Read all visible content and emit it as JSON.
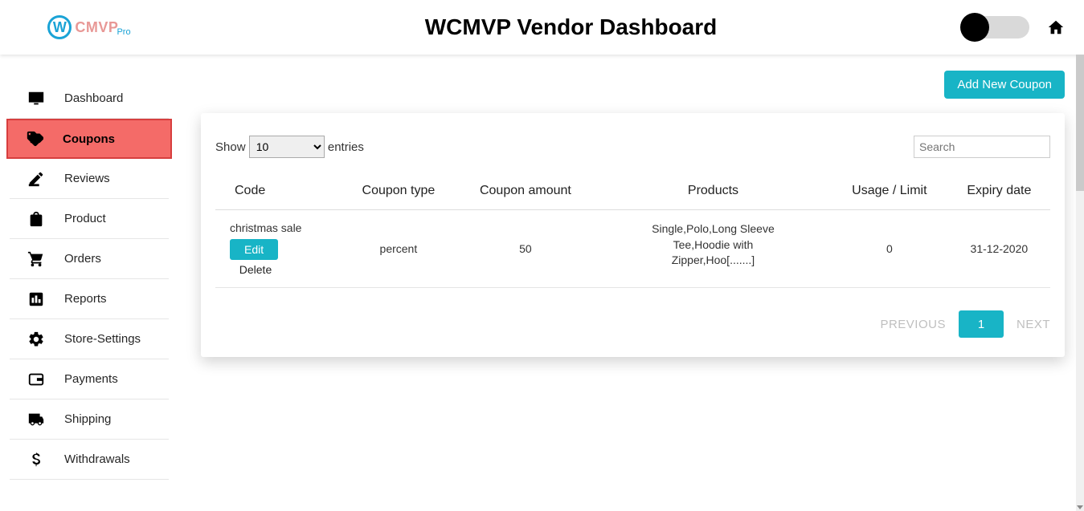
{
  "header": {
    "title": "WCMVP Vendor Dashboard",
    "logo_letter": "W",
    "logo_text": "CMVP",
    "logo_sub": "Pro"
  },
  "sidebar": {
    "items": [
      {
        "label": "Dashboard",
        "icon": "monitor-icon"
      },
      {
        "label": "Coupons",
        "icon": "tag-icon",
        "active": true
      },
      {
        "label": "Reviews",
        "icon": "edit-icon"
      },
      {
        "label": "Product",
        "icon": "bag-icon"
      },
      {
        "label": "Orders",
        "icon": "cart-icon"
      },
      {
        "label": "Reports",
        "icon": "chart-icon"
      },
      {
        "label": "Store-Settings",
        "icon": "gear-icon"
      },
      {
        "label": "Payments",
        "icon": "wallet-icon"
      },
      {
        "label": "Shipping",
        "icon": "truck-icon"
      },
      {
        "label": "Withdrawals",
        "icon": "dollar-icon"
      }
    ]
  },
  "actions": {
    "add_coupon": "Add New Coupon"
  },
  "table": {
    "show_label": "Show",
    "entries_label": "entries",
    "length_value": "10",
    "search_placeholder": "Search",
    "columns": [
      "Code",
      "Coupon type",
      "Coupon amount",
      "Products",
      "Usage / Limit",
      "Expiry date"
    ],
    "rows": [
      {
        "code": "christmas sale",
        "edit_label": "Edit",
        "delete_label": "Delete",
        "coupon_type": "percent",
        "coupon_amount": "50",
        "products": "Single,Polo,Long Sleeve Tee,Hoodie with Zipper,Hoo[.......]",
        "usage_limit": "0",
        "expiry": "31-12-2020"
      }
    ]
  },
  "pagination": {
    "previous": "PREVIOUS",
    "next": "NEXT",
    "current": "1"
  }
}
